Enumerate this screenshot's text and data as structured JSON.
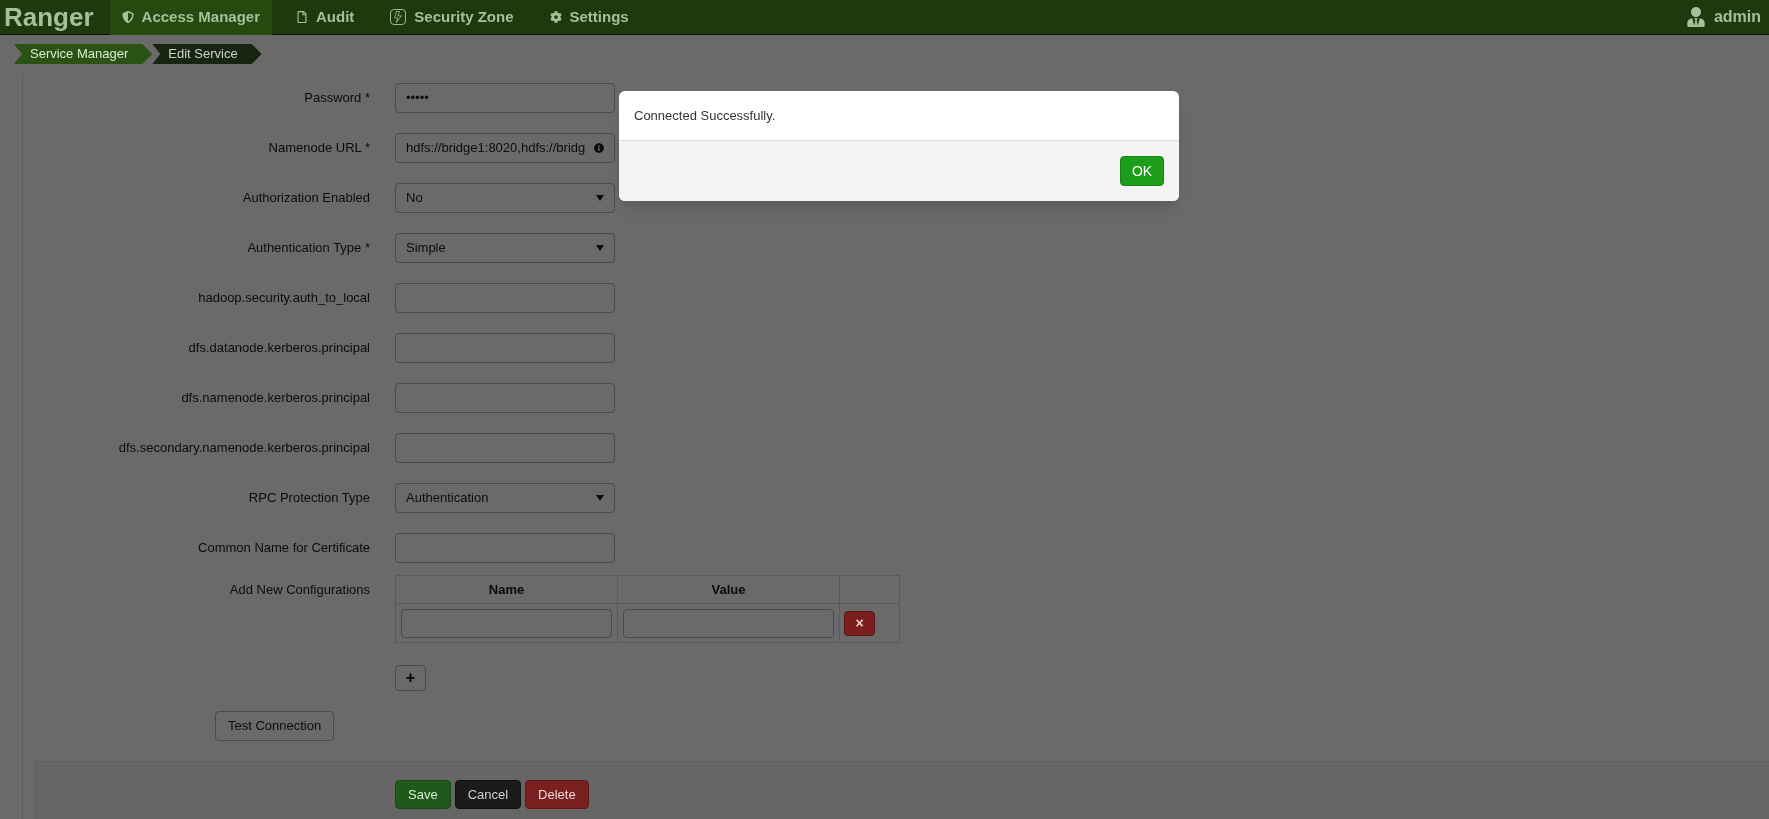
{
  "navbar": {
    "brand": "Ranger",
    "items": [
      {
        "label": "Access Manager",
        "selected": true
      },
      {
        "label": "Audit",
        "selected": false
      },
      {
        "label": "Security Zone",
        "selected": false
      },
      {
        "label": "Settings",
        "selected": false
      }
    ],
    "user": "admin"
  },
  "breadcrumb": [
    {
      "label": "Service Manager",
      "current": false
    },
    {
      "label": "Edit Service",
      "current": true
    }
  ],
  "form": {
    "fields": [
      {
        "label": "Password *",
        "kind": "text",
        "value": "•••••"
      },
      {
        "label": "Namenode URL *",
        "kind": "text",
        "value": "hdfs://bridge1:8020,hdfs://bridg",
        "info": true
      },
      {
        "label": "Authorization Enabled",
        "kind": "select",
        "value": "No"
      },
      {
        "label": "Authentication Type *",
        "kind": "select",
        "value": "Simple"
      },
      {
        "label": "hadoop.security.auth_to_local",
        "kind": "text"
      },
      {
        "label": "dfs.datanode.kerberos.principal",
        "kind": "text"
      },
      {
        "label": "dfs.namenode.kerberos.principal",
        "kind": "text"
      },
      {
        "label": "dfs.secondary.namenode.kerberos.principal",
        "kind": "text"
      },
      {
        "label": "RPC Protection Type",
        "kind": "select",
        "value": "Authentication"
      },
      {
        "label": "Common Name for Certificate",
        "kind": "text"
      }
    ],
    "configurations": {
      "label": "Add New Configurations",
      "columns": [
        "Name",
        "Value"
      ],
      "rows": [
        {}
      ],
      "add_button": "+",
      "remove_button": "×"
    },
    "test_button": "Test Connection",
    "actions": [
      {
        "label": "Save",
        "kind": "save"
      },
      {
        "label": "Cancel",
        "kind": "cancel"
      },
      {
        "label": "Delete",
        "kind": "delete"
      }
    ]
  },
  "dialog": {
    "message": "Connected Successfully.",
    "button": "OK"
  }
}
